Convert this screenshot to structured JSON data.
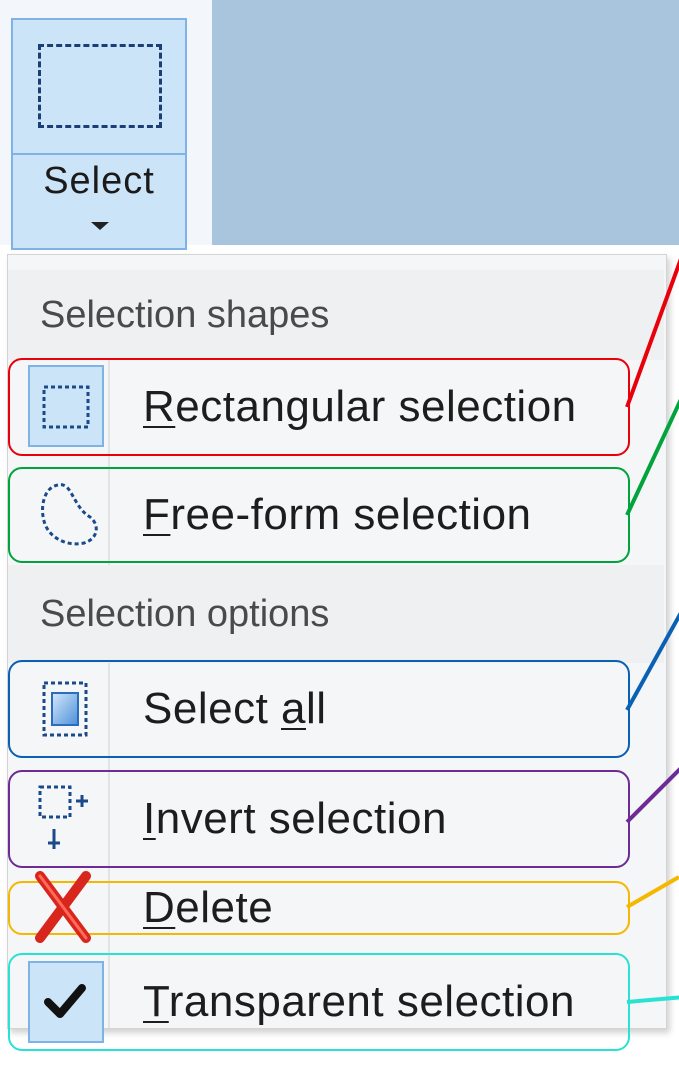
{
  "ribbon": {
    "select_button_label": "Select"
  },
  "menu": {
    "section_shapes": "Selection shapes",
    "section_options": "Selection options",
    "items": [
      {
        "id": "rectangular",
        "label_ul": "R",
        "label_rest": "ectangular selection",
        "checked": true,
        "icon": "rectangle-select-icon",
        "highlight": "#e8000b"
      },
      {
        "id": "freeform",
        "label_ul": "F",
        "label_rest": "ree-form selection",
        "checked": false,
        "icon": "freeform-select-icon",
        "highlight": "#00a33c"
      },
      {
        "id": "selectall",
        "label_pre": "Select ",
        "label_ul": "a",
        "label_rest": "ll",
        "checked": false,
        "icon": "select-all-icon",
        "highlight": "#0a60b3"
      },
      {
        "id": "invert",
        "label_ul": "I",
        "label_rest": "nvert selection",
        "checked": false,
        "icon": "invert-selection-icon",
        "highlight": "#6d2c95"
      },
      {
        "id": "delete",
        "label_ul": "D",
        "label_rest": "elete",
        "checked": false,
        "icon": "delete-icon",
        "highlight": "#f5b800"
      },
      {
        "id": "transparent",
        "label_ul": "T",
        "label_rest": "ransparent selection",
        "checked": true,
        "icon": "checkmark-icon",
        "highlight": "#28e3d3"
      }
    ]
  }
}
